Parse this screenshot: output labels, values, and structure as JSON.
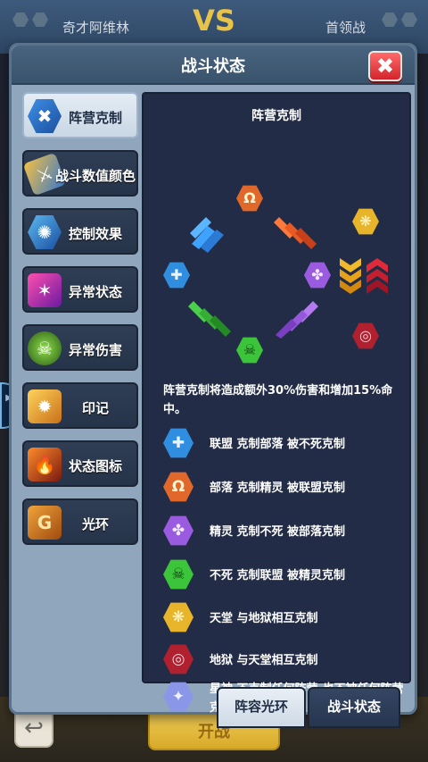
{
  "background": {
    "left_label": "奇才阿维林",
    "right_label": "首领战",
    "vs_label": "VS",
    "start_button": "开战",
    "back_icon": "back-arrow-icon"
  },
  "modal": {
    "title": "战斗状态",
    "close_label": "✖"
  },
  "sidebar": {
    "items": [
      {
        "label": "阵营克制",
        "icon": "faction-counter-icon",
        "active": true
      },
      {
        "label": "战斗数值颜色",
        "icon": "combat-number-color-icon"
      },
      {
        "label": "控制效果",
        "icon": "control-effect-icon"
      },
      {
        "label": "异常状态",
        "icon": "abnormal-status-icon"
      },
      {
        "label": "异常伤害",
        "icon": "abnormal-damage-icon"
      },
      {
        "label": "印记",
        "icon": "mark-icon"
      },
      {
        "label": "状态图标",
        "icon": "status-icon-icon"
      },
      {
        "label": "光环",
        "icon": "aura-icon"
      }
    ]
  },
  "content": {
    "title": "阵营克制",
    "description": "阵营克制将造成额外30%伤害和增加15%命中。",
    "legend": [
      {
        "text": "联盟 克制部落 被不死克制",
        "icon": "alliance-icon",
        "color": "#2f8ee0"
      },
      {
        "text": "部落 克制精灵 被联盟克制",
        "icon": "horde-icon",
        "color": "#e0682a"
      },
      {
        "text": "精灵 克制不死 被部落克制",
        "icon": "elf-icon",
        "color": "#9a5be0"
      },
      {
        "text": "不死 克制联盟 被精灵克制",
        "icon": "undead-icon",
        "color": "#3cc43a"
      },
      {
        "text": "天堂 与地狱相互克制",
        "icon": "heaven-icon",
        "color": "#e8b52a"
      },
      {
        "text": "地狱 与天堂相互克制",
        "icon": "hell-icon",
        "color": "#c0283a"
      },
      {
        "text": "星神 不克制任何阵营,也不被任何阵营克制",
        "icon": "star-god-icon",
        "color": "#8a96e8"
      }
    ]
  },
  "tabs": {
    "inactive_label": "阵容光环",
    "active_label": "战斗状态"
  }
}
